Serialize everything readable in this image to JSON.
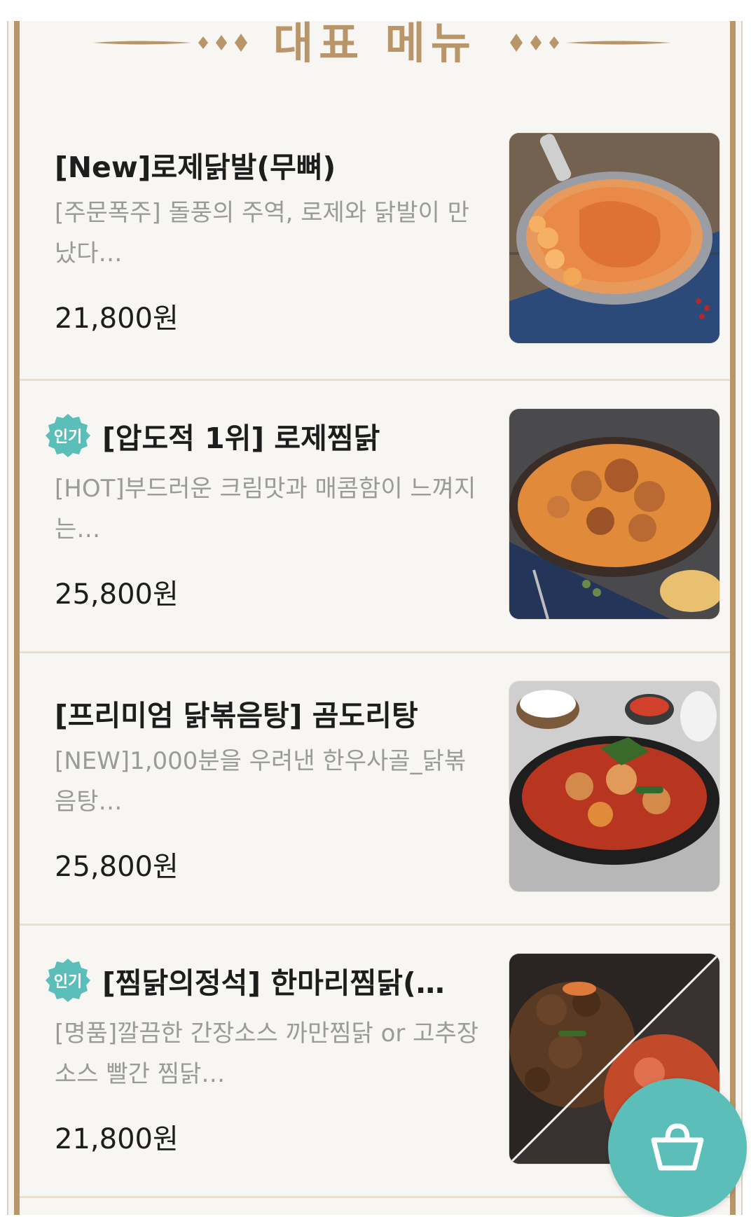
{
  "header": {
    "title": "대표 메뉴"
  },
  "menu": [
    {
      "badge": "",
      "title": "[New]로제닭발(무뼈)",
      "description": "[주문폭주] 돌풍의 주역, 로제와 닭발이 만났다…",
      "price": "21,800원"
    },
    {
      "badge": "인기",
      "title": "[압도적 1위] 로제찜닭",
      "description": "[HOT]부드러운 크림맛과 매콤함이 느껴지는…",
      "price": "25,800원"
    },
    {
      "badge": "",
      "title": "[프리미엄 닭볶음탕] 곰도리탕",
      "description": "[NEW]1,000분을 우려낸 한우사골_닭볶음탕…",
      "price": "25,800원"
    },
    {
      "badge": "인기",
      "title": "[찜닭의정석] 한마리찜닭(…",
      "description": "[명품]깔끔한 간장소스 까만찜닭 or 고추장소스 빨간 찜닭…",
      "price": "21,800원"
    }
  ],
  "colors": {
    "gold": "#b8966a",
    "teal": "#5cbeb9",
    "text": "#1d1d1d",
    "muted": "#9a9a9a"
  },
  "icons": {
    "cart": "shopping-basket-icon",
    "badge": "popular-badge-icon"
  }
}
